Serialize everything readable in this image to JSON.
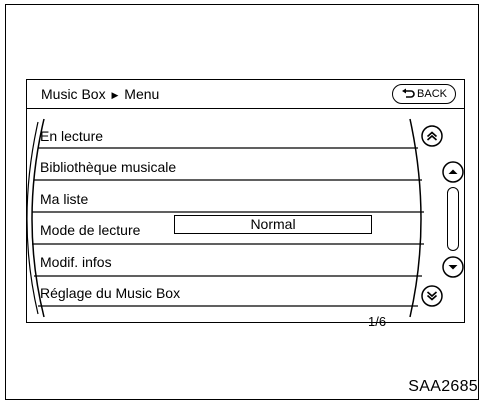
{
  "header": {
    "breadcrumb_root": "Music Box",
    "breadcrumb_sep": "▶",
    "breadcrumb_page": "Menu",
    "back_label": "BACK"
  },
  "menu": {
    "items": [
      {
        "label": "En lecture"
      },
      {
        "label": "Bibliothèque musicale"
      },
      {
        "label": "Ma liste"
      },
      {
        "label": "Mode de lecture",
        "value": "Normal"
      },
      {
        "label": "Modif. infos"
      },
      {
        "label": "Réglage du Music Box"
      }
    ],
    "page_indicator": "1/6"
  },
  "scroll_controls": {
    "icons": [
      "page-up-icon",
      "scroll-up-icon",
      "scroll-down-icon",
      "page-down-icon"
    ]
  },
  "figure_ref": "SAA2685"
}
